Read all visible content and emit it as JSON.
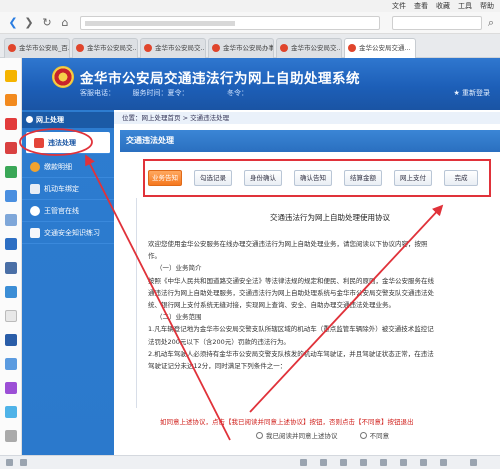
{
  "browser": {
    "menu": [
      "文件",
      "查看",
      "收藏",
      "工具",
      "帮助"
    ],
    "tabs": [
      {
        "label": "金华市公安局_百..."
      },
      {
        "label": "金华市公安局交..."
      },
      {
        "label": "金华市公安局交..."
      },
      {
        "label": "金华市公安局办事..."
      },
      {
        "label": "金华市公安局交..."
      },
      {
        "label": "金华公安局交通..."
      }
    ]
  },
  "header": {
    "title": "金华市公安局交通违法行为网上自助处理系统",
    "contact": "客服电话：　　　服务时间：夏令：　　　　　　冬令：",
    "right_text": "★ 重新登录"
  },
  "nav": {
    "heading": "网上处理",
    "items": [
      {
        "label": "违法处理"
      },
      {
        "label": "缴款明细"
      },
      {
        "label": "机动车绑定"
      },
      {
        "label": "王管官在线"
      },
      {
        "label": "交通安全知识练习"
      }
    ]
  },
  "breadcrumb": "位置：网上处理首页 > 交通违法处理",
  "content": {
    "heading": "交通违法处理",
    "steps": [
      "业务告知",
      "勾选记录",
      "身份确认",
      "确认告知",
      "结算金额",
      "网上支付",
      "完成"
    ],
    "doc_title": "交通违法行为网上自助处理使用协议",
    "doc_lines": [
      "欢迎您使用金华公安服务在线办理交通违法行为网上自助处理业务，请您阅读以下协议内容，按照",
      "作。",
      "（一）业务简介",
      "按照《中华人民共和国道路交通安全法》等法律法规的规定和便民、利民的原则，金华公安服务在线",
      "通违法行为网上自助处理服务，交通违法行为网上自助处理系统与金华市公安局交警支队交通违法处",
      "统、银行网上支付系统无缝对接，实现网上查询、安全、自助办理交通违法处理业务。",
      "",
      "（二）业务范围",
      "1.凡车辆登记地为金华市公安局交警支队所辖区域的机动车（重点监管车辆除外）被交通技术监控记",
      "法罚处200元以下（含200元）罚款的违法行为。",
      "2.机动车驾驶人必须持有金华市公安局交警支队核发的机动车驾驶证，并且驾驶证状态正常，在违法",
      "驾驶证记分未达12分，同时满足下列条件之一："
    ],
    "agree_text": "如同意上述协议，点击【我已阅读并同意上述协议】按钮，否则点击【不同意】按钮退出",
    "radio_agree": "我已阅读并同意上述协议",
    "radio_disagree": "不同意"
  },
  "colors": {
    "header_blue": "#1d5fb8",
    "nav_blue": "#2b79cc",
    "active_step": "#f5781f",
    "annotation_red": "#e0323a"
  }
}
